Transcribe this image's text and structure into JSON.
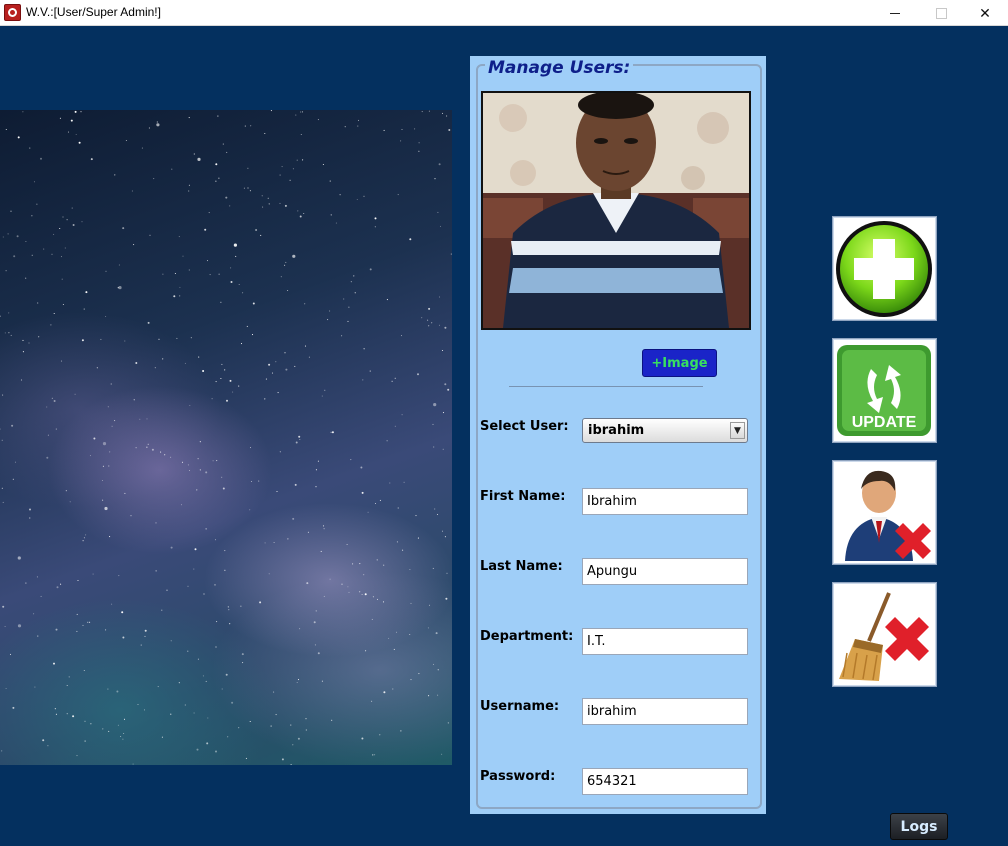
{
  "window": {
    "title": "W.V.:[User/Super Admin!]",
    "minimize_label": "",
    "maximize_label": "",
    "close_label": "✕"
  },
  "panel": {
    "legend": "Manage Users:",
    "add_image_label": "+Image"
  },
  "form": {
    "select_user": {
      "label": "Select User:",
      "value": "ibrahim"
    },
    "first_name": {
      "label": "First Name:",
      "value": "Ibrahim"
    },
    "last_name": {
      "label": "Last Name:",
      "value": "Apungu"
    },
    "department": {
      "label": "Department:",
      "value": "I.T."
    },
    "username": {
      "label": "Username:",
      "value": "ibrahim"
    },
    "password": {
      "label": "Password:",
      "value": "654321"
    }
  },
  "actions": {
    "update_text": "UPDATE",
    "logs_label": "Logs"
  },
  "colors": {
    "background": "#04305f",
    "panel": "#9fcef8",
    "legend_text": "#0e1f8a",
    "image_button": "#1a24c8",
    "image_button_text": "#38e060"
  }
}
